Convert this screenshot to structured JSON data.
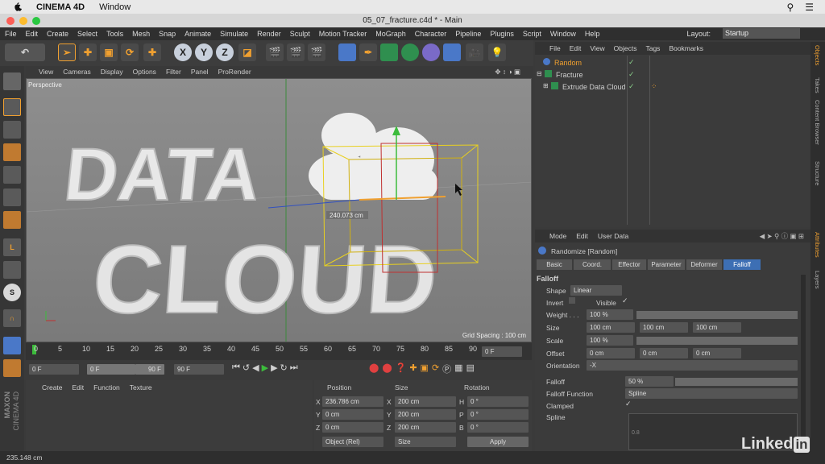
{
  "os": {
    "app_name": "CINEMA 4D",
    "window_menu": "Window"
  },
  "window": {
    "title": "05_07_fracture.c4d * - Main"
  },
  "menu": {
    "items": [
      "File",
      "Edit",
      "Create",
      "Select",
      "Tools",
      "Mesh",
      "Snap",
      "Animate",
      "Simulate",
      "Render",
      "Sculpt",
      "Motion Tracker",
      "MoGraph",
      "Character",
      "Pipeline",
      "Plugins",
      "Script",
      "Window",
      "Help"
    ],
    "layout_label": "Layout:",
    "layout_value": "Startup"
  },
  "toolbar": {
    "axis_x": "X",
    "axis_y": "Y",
    "axis_z": "Z"
  },
  "viewport": {
    "menu": [
      "View",
      "Cameras",
      "Display",
      "Options",
      "Filter",
      "Panel",
      "ProRender"
    ],
    "label": "Perspective",
    "text_line1": "DATA",
    "text_line2": "CLOUD",
    "readout": "240.073 cm",
    "grid_spacing": "Grid Spacing : 100 cm"
  },
  "timeline": {
    "ticks": [
      "0",
      "5",
      "10",
      "15",
      "20",
      "25",
      "30",
      "35",
      "40",
      "45",
      "50",
      "55",
      "60",
      "65",
      "70",
      "75",
      "80",
      "85",
      "90"
    ],
    "current_frame": "0 F",
    "start": "0 F",
    "range_start": "0 F",
    "range_end": "90 F",
    "end": "90 F"
  },
  "material": {
    "menu": [
      "Create",
      "Edit",
      "Function",
      "Texture"
    ]
  },
  "coords": {
    "headers": [
      "Position",
      "Size",
      "Rotation"
    ],
    "rows": [
      {
        "axis": "X",
        "pos": "236.786 cm",
        "saxis": "X",
        "size": "200 cm",
        "raxis": "H",
        "rot": "0 °"
      },
      {
        "axis": "Y",
        "pos": "0 cm",
        "saxis": "Y",
        "size": "200 cm",
        "raxis": "P",
        "rot": "0 °"
      },
      {
        "axis": "Z",
        "pos": "0 cm",
        "saxis": "Z",
        "size": "200 cm",
        "raxis": "B",
        "rot": "0 °"
      }
    ],
    "mode": "Object (Rel)",
    "size_mode": "Size",
    "apply": "Apply"
  },
  "status": {
    "text": "235.148 cm"
  },
  "objects": {
    "menu": [
      "File",
      "Edit",
      "View",
      "Objects",
      "Tags",
      "Bookmarks"
    ],
    "items": [
      "Random",
      "Fracture",
      "Extrude Data Cloud"
    ]
  },
  "attributes": {
    "menu": [
      "Mode",
      "Edit",
      "User Data"
    ],
    "title": "Randomize [Random]",
    "tabs": [
      "Basic",
      "Coord.",
      "Effector",
      "Parameter",
      "Deformer",
      "Falloff"
    ],
    "section": "Falloff",
    "shape_label": "Shape",
    "shape_value": "Linear",
    "invert_label": "Invert",
    "visible_label": "Visible",
    "weight_label": "Weight . . .",
    "weight_value": "100 %",
    "size_label": "Size",
    "size_x": "100 cm",
    "size_y": "100 cm",
    "size_z": "100 cm",
    "scale_label": "Scale",
    "scale_value": "100 %",
    "offset_label": "Offset",
    "offset_x": "0 cm",
    "offset_y": "0 cm",
    "offset_z": "0 cm",
    "orientation_label": "Orientation",
    "orientation_value": "-X",
    "falloff_label": "Falloff",
    "falloff_value": "50 %",
    "falloff_fn_label": "Falloff Function",
    "falloff_fn_value": "Spline",
    "clamped_label": "Clamped",
    "spline_label": "Spline",
    "spline_axis": "0.8"
  },
  "side_tabs": {
    "right": [
      "Objects",
      "Takes",
      "Content Browser",
      "Structure"
    ],
    "right_lower": [
      "Attributes",
      "Layers"
    ]
  },
  "brand": {
    "maxon": "MAXON",
    "cinema": "CINEMA 4D",
    "linkedin": "Linked",
    "linkedin_in": "in"
  },
  "colors": {
    "accent_orange": "#f0a030",
    "selection_blue": "#4a78c8",
    "tab_active": "#3d6fb4"
  }
}
